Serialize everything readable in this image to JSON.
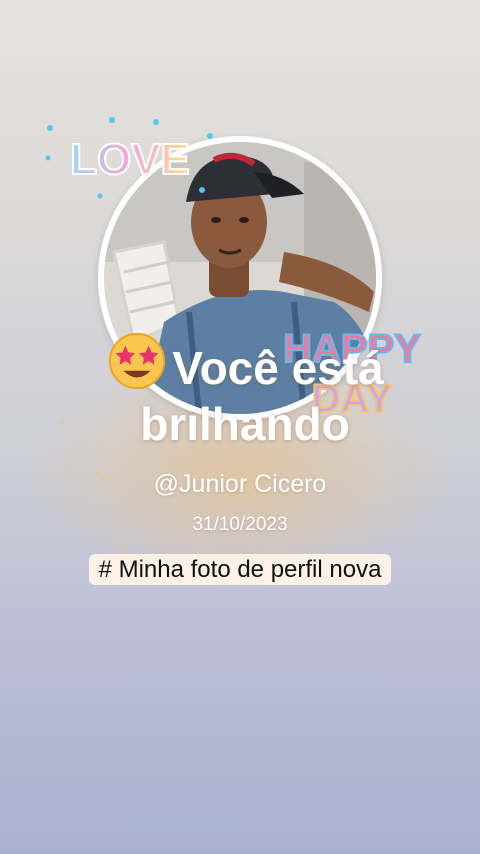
{
  "story": {
    "headline": "Você está brilhando",
    "handle": "@Junior Cicero",
    "date": "31/10/2023",
    "caption": "# Minha foto de perfil nova"
  },
  "stickers": {
    "love": "LOVE",
    "happy": "HAPPY",
    "day": "DAY"
  },
  "icons": {
    "headline_emoji": "star-struck-emoji"
  },
  "colors": {
    "bg_top": "#e6e2dc",
    "bg_bottom": "#aab0d0",
    "text": "#ffffff",
    "caption_bg": "#fbf1e6"
  }
}
